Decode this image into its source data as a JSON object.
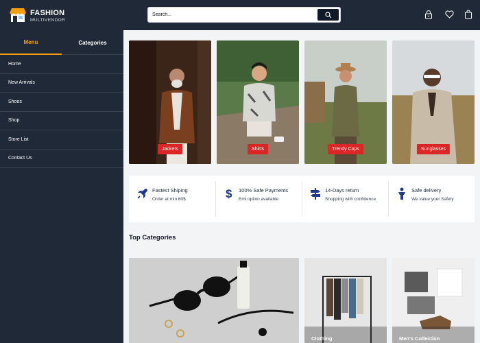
{
  "header": {
    "brand_title": "FASHION",
    "brand_subtitle": "MULTIVENDOR",
    "search_placeholder": "Search...",
    "icons": [
      "store-icon",
      "search-icon",
      "lock-icon",
      "heart-icon",
      "cart-icon"
    ]
  },
  "sidebar": {
    "tabs": [
      {
        "label": "Menu",
        "active": true
      },
      {
        "label": "Categories",
        "active": false
      }
    ],
    "items": [
      {
        "label": "Home"
      },
      {
        "label": "New Arrivals"
      },
      {
        "label": "Shoes"
      },
      {
        "label": "Shop"
      },
      {
        "label": "Store List"
      },
      {
        "label": "Contact Us"
      }
    ]
  },
  "banners": [
    {
      "label": "Jackets"
    },
    {
      "label": "Shirts"
    },
    {
      "label": "Trendy Caps"
    },
    {
      "label": "Sunglasses"
    }
  ],
  "features": [
    {
      "title": "Fastest Shiping",
      "subtitle": "Order at min 60$",
      "icon": "rocket-icon"
    },
    {
      "title": "100% Safe Payments",
      "subtitle": "Emi option available",
      "icon": "dollar-icon"
    },
    {
      "title": "14-Days return",
      "subtitle": "Shopping with confidence",
      "icon": "signpost-icon"
    },
    {
      "title": "Safe delivery",
      "subtitle": "We value your Safety",
      "icon": "person-icon"
    }
  ],
  "top_categories": {
    "title": "Top Categories",
    "items": [
      {
        "label": ""
      },
      {
        "label": "Clothing"
      },
      {
        "label": "Men's Collection"
      }
    ]
  },
  "colors": {
    "sidebar_bg": "#1f2937",
    "accent": "#f59e0b",
    "badge": "#dc2626",
    "content_bg": "#f3f4f6"
  }
}
